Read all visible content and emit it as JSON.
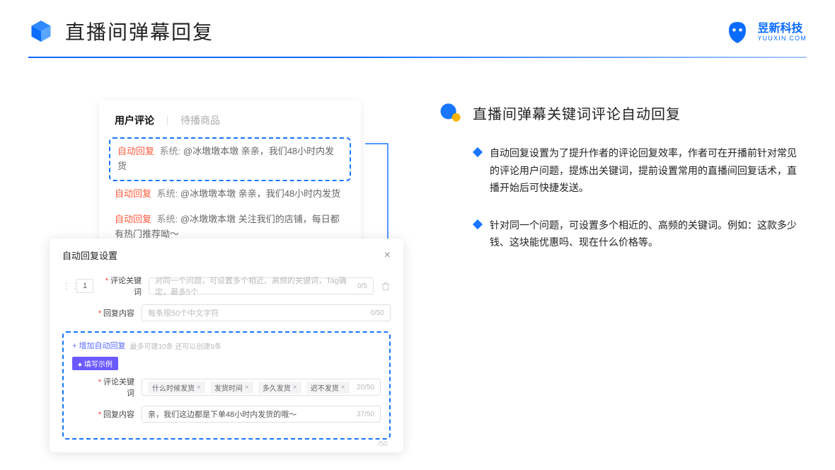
{
  "header": {
    "title": "直播间弹幕回复",
    "brand_cn": "昱新科技",
    "brand_en": "YUUXIN.COM"
  },
  "comments": {
    "tab_active": "用户评论",
    "tab_inactive": "待播商品",
    "items": [
      {
        "tag": "自动回复",
        "sys": "系统:",
        "text": "@冰墩墩本墩 亲亲，我们48小时内发货",
        "highlight": true
      },
      {
        "tag": "自动回复",
        "sys": "系统:",
        "text": "@冰墩墩本墩 亲亲，我们48小时内发货",
        "highlight": false
      },
      {
        "tag": "自动回复",
        "sys": "系统:",
        "text": "@冰墩墩本墩 关注我们的店铺，每日都有热门推荐呦～",
        "highlight": false
      }
    ]
  },
  "modal": {
    "title": "自动回复设置",
    "row_num": "1",
    "field1_label": "评论关键词",
    "field1_placeholder": "对同一个问题，可设置多个相近、高频的关键词，Tag确定，最多5个",
    "field1_counter": "0/5",
    "field2_label": "回复内容",
    "field2_placeholder": "每条限50个中文字符",
    "field2_counter": "0/50",
    "add_text": "+ 增加自动回复",
    "add_hint": "最多可建10条 还可以创建9条",
    "example_label": "● 填写示例",
    "ex_field1_label": "评论关键词",
    "ex_tags": [
      "什么时候发货",
      "发货时间",
      "多久发货",
      "迟不发货"
    ],
    "ex_field1_counter": "20/50",
    "ex_field2_label": "回复内容",
    "ex_field2_value": "亲，我们这边都是下单48小时内发货的哦～",
    "ex_field2_counter": "37/50",
    "overflow_counter": "/50"
  },
  "right": {
    "section_title": "直播间弹幕关键词评论自动回复",
    "bullets": [
      "自动回复设置为了提升作者的评论回复效率，作者可在开播前针对常见的评论用户问题，提炼出关键词，提前设置常用的直播间回复话术，直播开始后可快捷发送。",
      "针对同一个问题，可设置多个相近的、高频的关键词。例如：这款多少钱、这块能优惠吗、现在什么价格等。"
    ]
  }
}
